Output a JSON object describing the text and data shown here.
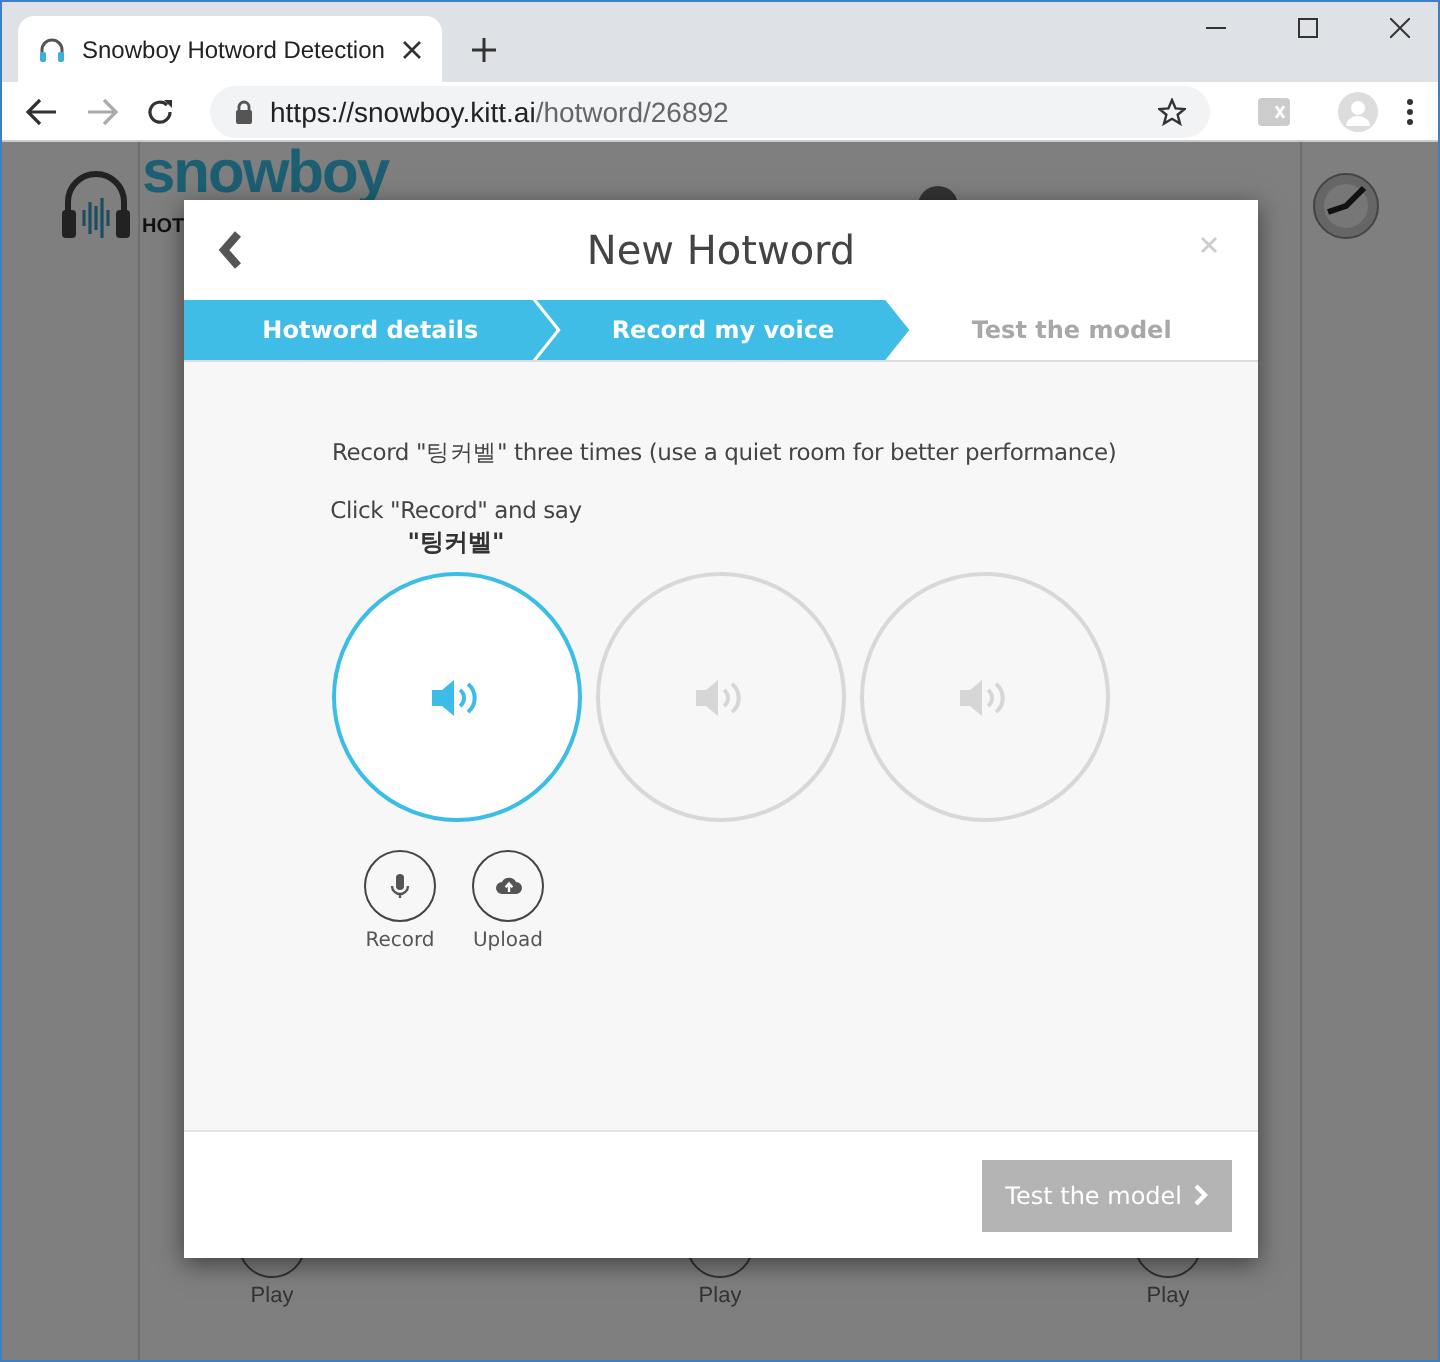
{
  "browser": {
    "tab_title": "Snowboy Hotword Detection",
    "url_host": "https://snowboy.kitt.ai",
    "url_path": "/hotword/26892"
  },
  "background_page": {
    "logo": "snowboy",
    "logo_sub": "HOT",
    "play_labels": [
      "Play",
      "Play",
      "Play"
    ]
  },
  "dialog": {
    "title": "New Hotword",
    "steps": [
      {
        "label": "Hotword details",
        "reached": true
      },
      {
        "label": "Record my voice",
        "reached": true
      },
      {
        "label": "Test the model",
        "reached": false
      }
    ],
    "instruction": "Record \"팅커벨\" three times (use a quiet room for better performance)",
    "prompt": "Click \"Record\" and say",
    "hotword": "\"팅커벨\"",
    "samples": [
      {
        "selected": true
      },
      {
        "selected": false
      },
      {
        "selected": false
      }
    ],
    "actions": [
      {
        "label": "Record",
        "kind": "record"
      },
      {
        "label": "Upload",
        "kind": "upload"
      }
    ],
    "next_button": {
      "label": "Test the model",
      "disabled": true
    }
  }
}
